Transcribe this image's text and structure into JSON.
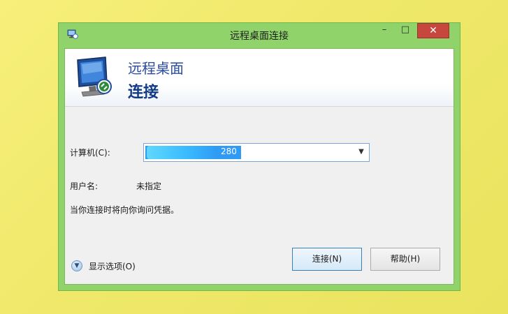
{
  "window": {
    "title": "远程桌面连接",
    "controls": {
      "minimize": "–",
      "maximize": "□",
      "close": "✕"
    }
  },
  "header": {
    "line1": "远程桌面",
    "line2": "连接"
  },
  "form": {
    "computer_label": "计算机(C):",
    "computer_value_visible": "280",
    "username_label": "用户名:",
    "username_value": "未指定",
    "info_text": "当你连接时将向你询问凭据。"
  },
  "footer": {
    "show_options": "显示选项(O)",
    "connect_button": "连接(N)",
    "help_button": "帮助(H)"
  },
  "icons": {
    "app": "remote-desktop-icon",
    "monitor": "monitor-icon",
    "dropdown": "chevron-down-icon",
    "expand": "expand-circle-icon"
  },
  "colors": {
    "window_frame": "#8fd36a",
    "close_button": "#c7463e",
    "selection": "#2f9bf4",
    "header_text": "#2a4aa0"
  }
}
